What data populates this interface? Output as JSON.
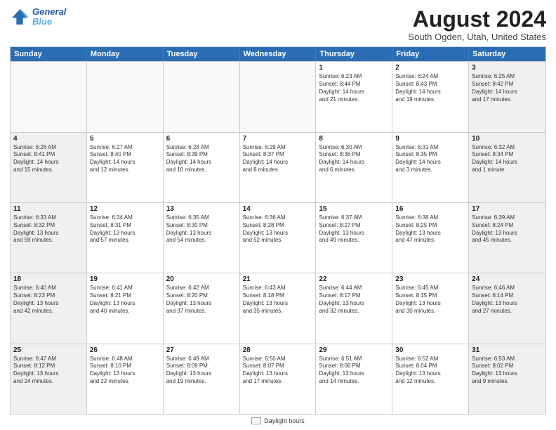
{
  "header": {
    "logo_line1": "General",
    "logo_line2": "Blue",
    "month_title": "August 2024",
    "location": "South Ogden, Utah, United States"
  },
  "days_of_week": [
    "Sunday",
    "Monday",
    "Tuesday",
    "Wednesday",
    "Thursday",
    "Friday",
    "Saturday"
  ],
  "weeks": [
    [
      {
        "day": "",
        "empty": true
      },
      {
        "day": "",
        "empty": true
      },
      {
        "day": "",
        "empty": true
      },
      {
        "day": "",
        "empty": true
      },
      {
        "day": "1",
        "lines": [
          "Sunrise: 6:23 AM",
          "Sunset: 8:44 PM",
          "Daylight: 14 hours",
          "and 21 minutes."
        ]
      },
      {
        "day": "2",
        "lines": [
          "Sunrise: 6:24 AM",
          "Sunset: 8:43 PM",
          "Daylight: 14 hours",
          "and 19 minutes."
        ]
      },
      {
        "day": "3",
        "lines": [
          "Sunrise: 6:25 AM",
          "Sunset: 8:42 PM",
          "Daylight: 14 hours",
          "and 17 minutes."
        ]
      }
    ],
    [
      {
        "day": "4",
        "lines": [
          "Sunrise: 6:26 AM",
          "Sunset: 8:41 PM",
          "Daylight: 14 hours",
          "and 15 minutes."
        ]
      },
      {
        "day": "5",
        "lines": [
          "Sunrise: 6:27 AM",
          "Sunset: 8:40 PM",
          "Daylight: 14 hours",
          "and 12 minutes."
        ]
      },
      {
        "day": "6",
        "lines": [
          "Sunrise: 6:28 AM",
          "Sunset: 8:39 PM",
          "Daylight: 14 hours",
          "and 10 minutes."
        ]
      },
      {
        "day": "7",
        "lines": [
          "Sunrise: 6:29 AM",
          "Sunset: 8:37 PM",
          "Daylight: 14 hours",
          "and 8 minutes."
        ]
      },
      {
        "day": "8",
        "lines": [
          "Sunrise: 6:30 AM",
          "Sunset: 8:36 PM",
          "Daylight: 14 hours",
          "and 6 minutes."
        ]
      },
      {
        "day": "9",
        "lines": [
          "Sunrise: 6:31 AM",
          "Sunset: 8:35 PM",
          "Daylight: 14 hours",
          "and 3 minutes."
        ]
      },
      {
        "day": "10",
        "lines": [
          "Sunrise: 6:32 AM",
          "Sunset: 8:34 PM",
          "Daylight: 14 hours",
          "and 1 minute."
        ]
      }
    ],
    [
      {
        "day": "11",
        "lines": [
          "Sunrise: 6:33 AM",
          "Sunset: 8:32 PM",
          "Daylight: 13 hours",
          "and 59 minutes."
        ]
      },
      {
        "day": "12",
        "lines": [
          "Sunrise: 6:34 AM",
          "Sunset: 8:31 PM",
          "Daylight: 13 hours",
          "and 57 minutes."
        ]
      },
      {
        "day": "13",
        "lines": [
          "Sunrise: 6:35 AM",
          "Sunset: 8:30 PM",
          "Daylight: 13 hours",
          "and 54 minutes."
        ]
      },
      {
        "day": "14",
        "lines": [
          "Sunrise: 6:36 AM",
          "Sunset: 8:28 PM",
          "Daylight: 13 hours",
          "and 52 minutes."
        ]
      },
      {
        "day": "15",
        "lines": [
          "Sunrise: 6:37 AM",
          "Sunset: 8:27 PM",
          "Daylight: 13 hours",
          "and 49 minutes."
        ]
      },
      {
        "day": "16",
        "lines": [
          "Sunrise: 6:38 AM",
          "Sunset: 8:25 PM",
          "Daylight: 13 hours",
          "and 47 minutes."
        ]
      },
      {
        "day": "17",
        "lines": [
          "Sunrise: 6:39 AM",
          "Sunset: 8:24 PM",
          "Daylight: 13 hours",
          "and 45 minutes."
        ]
      }
    ],
    [
      {
        "day": "18",
        "lines": [
          "Sunrise: 6:40 AM",
          "Sunset: 8:23 PM",
          "Daylight: 13 hours",
          "and 42 minutes."
        ]
      },
      {
        "day": "19",
        "lines": [
          "Sunrise: 6:41 AM",
          "Sunset: 8:21 PM",
          "Daylight: 13 hours",
          "and 40 minutes."
        ]
      },
      {
        "day": "20",
        "lines": [
          "Sunrise: 6:42 AM",
          "Sunset: 8:20 PM",
          "Daylight: 13 hours",
          "and 37 minutes."
        ]
      },
      {
        "day": "21",
        "lines": [
          "Sunrise: 6:43 AM",
          "Sunset: 8:18 PM",
          "Daylight: 13 hours",
          "and 35 minutes."
        ]
      },
      {
        "day": "22",
        "lines": [
          "Sunrise: 6:44 AM",
          "Sunset: 8:17 PM",
          "Daylight: 13 hours",
          "and 32 minutes."
        ]
      },
      {
        "day": "23",
        "lines": [
          "Sunrise: 6:45 AM",
          "Sunset: 8:15 PM",
          "Daylight: 13 hours",
          "and 30 minutes."
        ]
      },
      {
        "day": "24",
        "lines": [
          "Sunrise: 6:46 AM",
          "Sunset: 8:14 PM",
          "Daylight: 13 hours",
          "and 27 minutes."
        ]
      }
    ],
    [
      {
        "day": "25",
        "lines": [
          "Sunrise: 6:47 AM",
          "Sunset: 8:12 PM",
          "Daylight: 13 hours",
          "and 24 minutes."
        ]
      },
      {
        "day": "26",
        "lines": [
          "Sunrise: 6:48 AM",
          "Sunset: 8:10 PM",
          "Daylight: 13 hours",
          "and 22 minutes."
        ]
      },
      {
        "day": "27",
        "lines": [
          "Sunrise: 6:49 AM",
          "Sunset: 8:09 PM",
          "Daylight: 13 hours",
          "and 19 minutes."
        ]
      },
      {
        "day": "28",
        "lines": [
          "Sunrise: 6:50 AM",
          "Sunset: 8:07 PM",
          "Daylight: 13 hours",
          "and 17 minutes."
        ]
      },
      {
        "day": "29",
        "lines": [
          "Sunrise: 6:51 AM",
          "Sunset: 8:06 PM",
          "Daylight: 13 hours",
          "and 14 minutes."
        ]
      },
      {
        "day": "30",
        "lines": [
          "Sunrise: 6:52 AM",
          "Sunset: 8:04 PM",
          "Daylight: 13 hours",
          "and 12 minutes."
        ]
      },
      {
        "day": "31",
        "lines": [
          "Sunrise: 6:53 AM",
          "Sunset: 8:02 PM",
          "Daylight: 13 hours",
          "and 9 minutes."
        ]
      }
    ]
  ],
  "legend": {
    "daylight_label": "Daylight hours",
    "daylight_color": "#fff9c4"
  }
}
